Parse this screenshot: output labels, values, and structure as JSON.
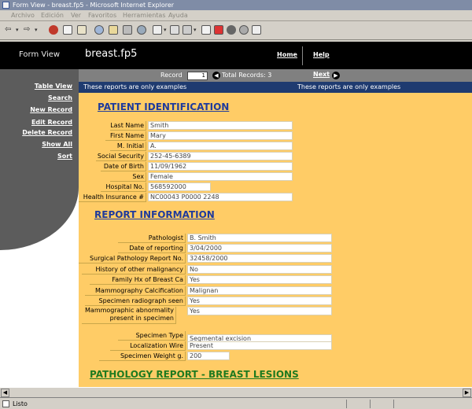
{
  "window": {
    "title": "Form View - breast.fp5 - Microsoft Internet Explorer"
  },
  "menu": [
    "Archivo",
    "Edición",
    "Ver",
    "Favoritos",
    "Herramientas",
    "Ayuda"
  ],
  "header": {
    "form_view_label": "Form View",
    "file_title": "breast.fp5",
    "home_link": "Home",
    "help_link": "Help"
  },
  "sidebar": {
    "table_view": "Table View",
    "search": "Search",
    "new_record": "New Record",
    "edit_record": "Edit Record",
    "delete_record": "Delete Record",
    "show_all": "Show All",
    "sort": "Sort"
  },
  "record_bar": {
    "record_label": "Record",
    "record_value": "1",
    "total_label": "Total Records: 3",
    "next_link": "Next"
  },
  "notice": {
    "left": "These reports are only examples",
    "right": "These reports are only examples"
  },
  "patient": {
    "title": "PATIENT IDENTIFICATION",
    "fields": [
      {
        "label": "Last Name",
        "value": "Smith"
      },
      {
        "label": "First Name",
        "value": "Mary"
      },
      {
        "label": "M. Initial",
        "value": "A."
      },
      {
        "label": "Social Security",
        "value": "252-45-6389"
      },
      {
        "label": "Date of Birth",
        "value": "11/09/1962"
      },
      {
        "label": "Sex",
        "value": "Female"
      },
      {
        "label": "Hospital No.",
        "value": "568592000"
      },
      {
        "label": "Health Insurance #",
        "value": "NC00043 P0000 2248"
      }
    ]
  },
  "report": {
    "title": "REPORT INFORMATION",
    "fields": [
      {
        "label": "Pathologist",
        "value": "B. Smith"
      },
      {
        "label": "Date of reporting",
        "value": "3/04/2000"
      },
      {
        "label": "Surgical Pathology Report No.",
        "value": "32458/2000"
      },
      {
        "label": "History of other malignancy",
        "value": "No"
      },
      {
        "label": "Family Hx of Breast Ca",
        "value": "Yes"
      },
      {
        "label": "Mammography Calcification",
        "value": "Malignan"
      },
      {
        "label": "Specimen radiograph seen",
        "value": "Yes"
      },
      {
        "label": "Mammographic abnormality present in specimen",
        "value": "Yes"
      }
    ]
  },
  "specimen": {
    "fields": [
      {
        "label": "Specimen Type",
        "value": "Segmental excision"
      },
      {
        "label": "Localization Wire",
        "value": "Present"
      },
      {
        "label": "Specimen Weight g.",
        "value": "200"
      }
    ]
  },
  "pathology": {
    "title": "PATHOLOGY REPORT - BREAST LESIONS"
  },
  "status": {
    "text": "Listo"
  }
}
